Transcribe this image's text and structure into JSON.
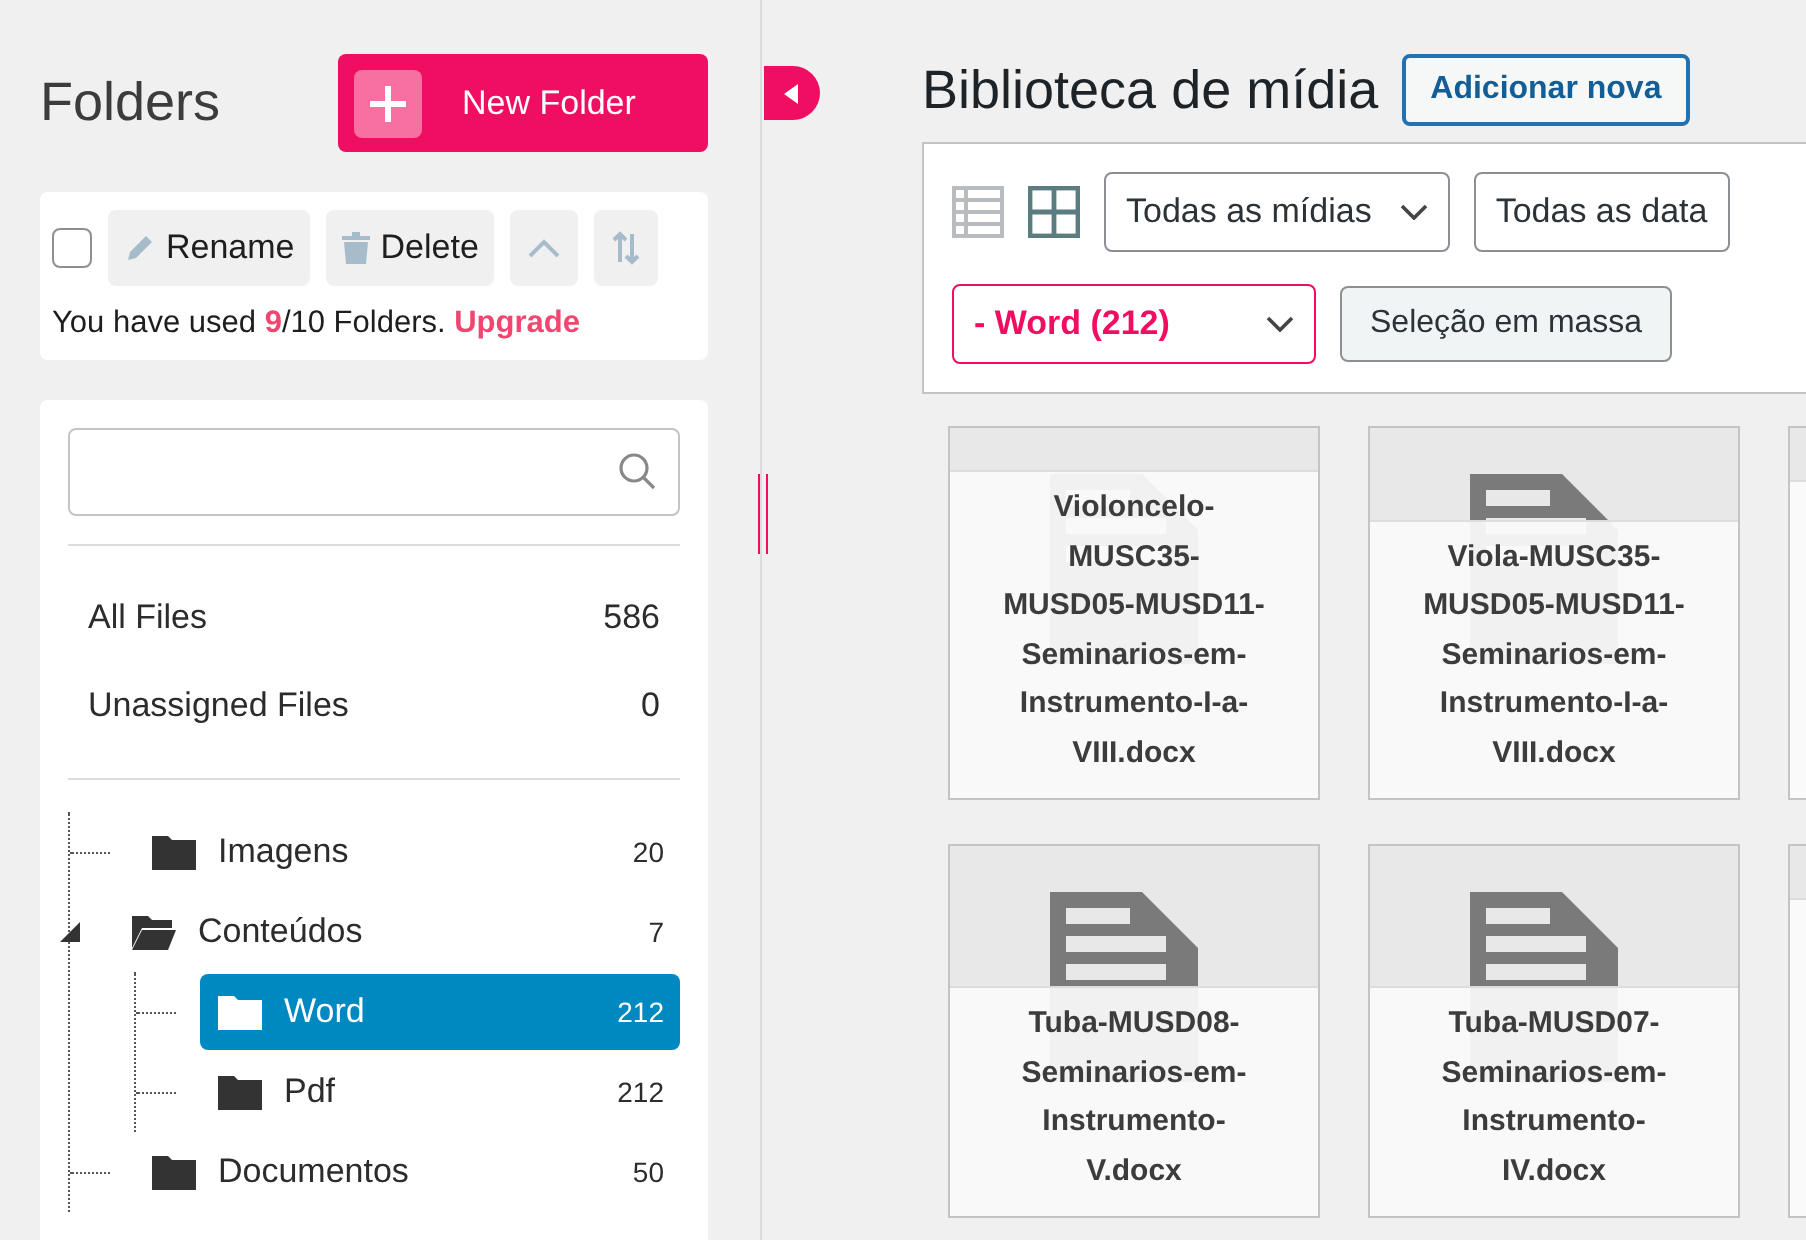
{
  "sidebar": {
    "title": "Folders",
    "new_folder_button": "New Folder",
    "toolbar": {
      "select_all_checked": false,
      "rename": "Rename",
      "delete": "Delete"
    },
    "usage": "You have used **9**/10 Folders.",
    "upgrade_link": "Upgrade",
    "special_items": [
      {
        "label": "All Files",
        "count": "586"
      },
      {
        "label": "Unassigned Files",
        "count": "0"
      }
    ],
    "tree": [
      {
        "label": "Imagens",
        "count": "20",
        "selected": false,
        "expanded": false
      },
      {
        "label": "Conteúdos",
        "count": "7",
        "selected": false,
        "expanded": true,
        "children": [
          {
            "label": "Word",
            "count": "212",
            "selected": true,
            "expanded": false
          },
          {
            "label": "Pdf",
            "count": "212",
            "selected": false,
            "expanded": false
          }
        ]
      },
      {
        "label": "Documentos",
        "count": "50",
        "selected": false,
        "expanded": false
      }
    ]
  },
  "main": {
    "title": "Biblioteca de mídia",
    "add_new_button": "Adicionar nova",
    "view_mode": [
      {
        "kind": "list",
        "selected": false
      },
      {
        "kind": "grid",
        "selected": true
      }
    ],
    "filters": [
      "Todas as mídias",
      "Todas as data"
    ],
    "folder_filter": "- Word (212)",
    "bulk_select_button": "Seleção em massa",
    "files": [
      {
        "name_lines": [
          "Violoncelo-",
          "MUSC35-",
          "MUSD05-MUSD11-",
          "Seminarios-em-",
          "Instrumento-I-a-",
          "VIII.docx"
        ]
      },
      {
        "name_lines": [
          "Viola-MUSC35-",
          "MUSD05-MUSD11-",
          "Seminarios-em-",
          "Instrumento-I-a-",
          "VIII.docx"
        ]
      },
      {
        "kind": "cut"
      },
      {
        "name_lines": [
          "Tuba-MUSD08-",
          "Seminarios-em-",
          "Instrumento-",
          "V.docx"
        ]
      },
      {
        "name_lines": [
          "Tuba-MUSD07-",
          "Seminarios-em-",
          "Instrumento-",
          "IV.docx"
        ]
      },
      {
        "kind": "cut"
      }
    ]
  }
}
